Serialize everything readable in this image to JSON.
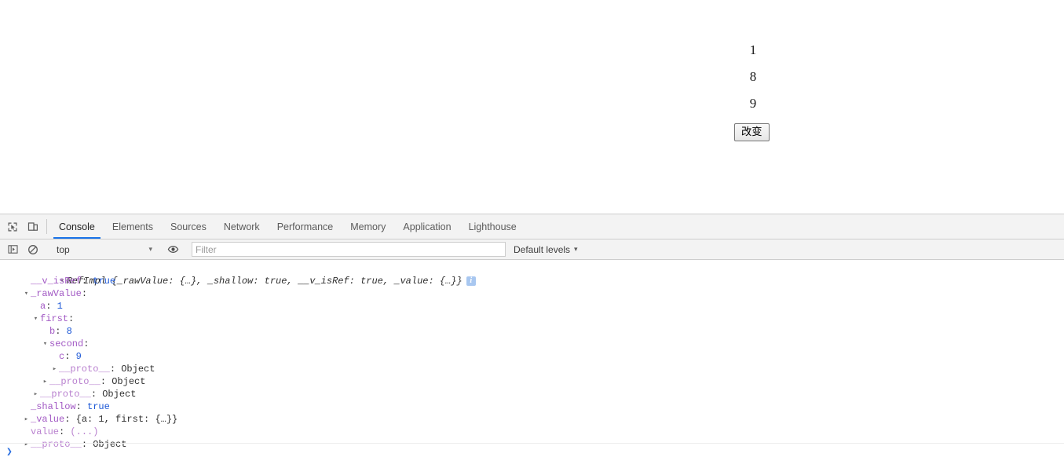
{
  "page": {
    "values": [
      {
        "id": "num-a",
        "text": "1"
      },
      {
        "id": "num-b",
        "text": "8"
      },
      {
        "id": "num-c",
        "text": "9"
      }
    ],
    "button_label": "改变"
  },
  "devtools": {
    "toolbar_icons": [
      {
        "name": "inspect-element-icon",
        "title": "Inspect element"
      },
      {
        "name": "device-toolbar-icon",
        "title": "Toggle device toolbar"
      }
    ],
    "tabs": [
      {
        "label": "Console",
        "active": true
      },
      {
        "label": "Elements",
        "active": false
      },
      {
        "label": "Sources",
        "active": false
      },
      {
        "label": "Network",
        "active": false
      },
      {
        "label": "Performance",
        "active": false
      },
      {
        "label": "Memory",
        "active": false
      },
      {
        "label": "Application",
        "active": false
      },
      {
        "label": "Lighthouse",
        "active": false
      }
    ],
    "active_tab_underline_color": "#1a73e8",
    "filter_bar": {
      "sidebar_icon": "console-sidebar-icon",
      "clear_icon": "clear-console-icon",
      "context": "top",
      "context_caret": "▾",
      "live_expression_icon": "eye-icon",
      "filter_placeholder": "Filter",
      "filter_value": "",
      "levels": "Default levels",
      "levels_caret": "▾"
    },
    "console": {
      "message": {
        "expand_arrow": "▾",
        "title": "RefImpl {_rawValue: {…}, _shallow: true, __v_isRef: true, _value: {…}}",
        "info_badge": "i",
        "lines": [
          {
            "arrow": "",
            "indent": 1,
            "key": "__v_isRef",
            "key_style": "prop",
            "sep": ": ",
            "value": "true",
            "value_style": "bool"
          },
          {
            "arrow": "▾",
            "indent": 1,
            "key": "_rawValue",
            "key_style": "prop",
            "sep": ":",
            "value": "",
            "value_style": "none"
          },
          {
            "arrow": "",
            "indent": 2,
            "key": "a",
            "key_style": "prop",
            "sep": ": ",
            "value": "1",
            "value_style": "num"
          },
          {
            "arrow": "▾",
            "indent": 2,
            "key": "first",
            "key_style": "prop",
            "sep": ":",
            "value": "",
            "value_style": "none"
          },
          {
            "arrow": "",
            "indent": 3,
            "key": "b",
            "key_style": "prop",
            "sep": ": ",
            "value": "8",
            "value_style": "num"
          },
          {
            "arrow": "▾",
            "indent": 3,
            "key": "second",
            "key_style": "prop",
            "sep": ":",
            "value": "",
            "value_style": "none"
          },
          {
            "arrow": "",
            "indent": 4,
            "key": "c",
            "key_style": "prop",
            "sep": ": ",
            "value": "9",
            "value_style": "num"
          },
          {
            "arrow": "▸",
            "indent": 4,
            "key": "__proto__",
            "key_style": "proto",
            "sep": ": ",
            "value": "Object",
            "value_style": "plain"
          },
          {
            "arrow": "▸",
            "indent": 3,
            "key": "__proto__",
            "key_style": "proto",
            "sep": ": ",
            "value": "Object",
            "value_style": "plain"
          },
          {
            "arrow": "▸",
            "indent": 2,
            "key": "__proto__",
            "key_style": "proto",
            "sep": ": ",
            "value": "Object",
            "value_style": "plain"
          },
          {
            "arrow": "",
            "indent": 1,
            "key": "_shallow",
            "key_style": "prop",
            "sep": ": ",
            "value": "true",
            "value_style": "bool"
          },
          {
            "arrow": "▸",
            "indent": 1,
            "key": "_value",
            "key_style": "prop",
            "sep": ": ",
            "value": "{a: 1, first: {…}}",
            "value_style": "objpreview"
          },
          {
            "arrow": "",
            "indent": 1,
            "key": "value",
            "key_style": "getter",
            "sep": ": ",
            "value": "(...)",
            "value_style": "getter"
          },
          {
            "arrow": "▸",
            "indent": 1,
            "key": "__proto__",
            "key_style": "proto",
            "sep": ": ",
            "value": "Object",
            "value_style": "plain"
          }
        ]
      },
      "prompt_chevron": "❯",
      "prompt_value": ""
    }
  }
}
